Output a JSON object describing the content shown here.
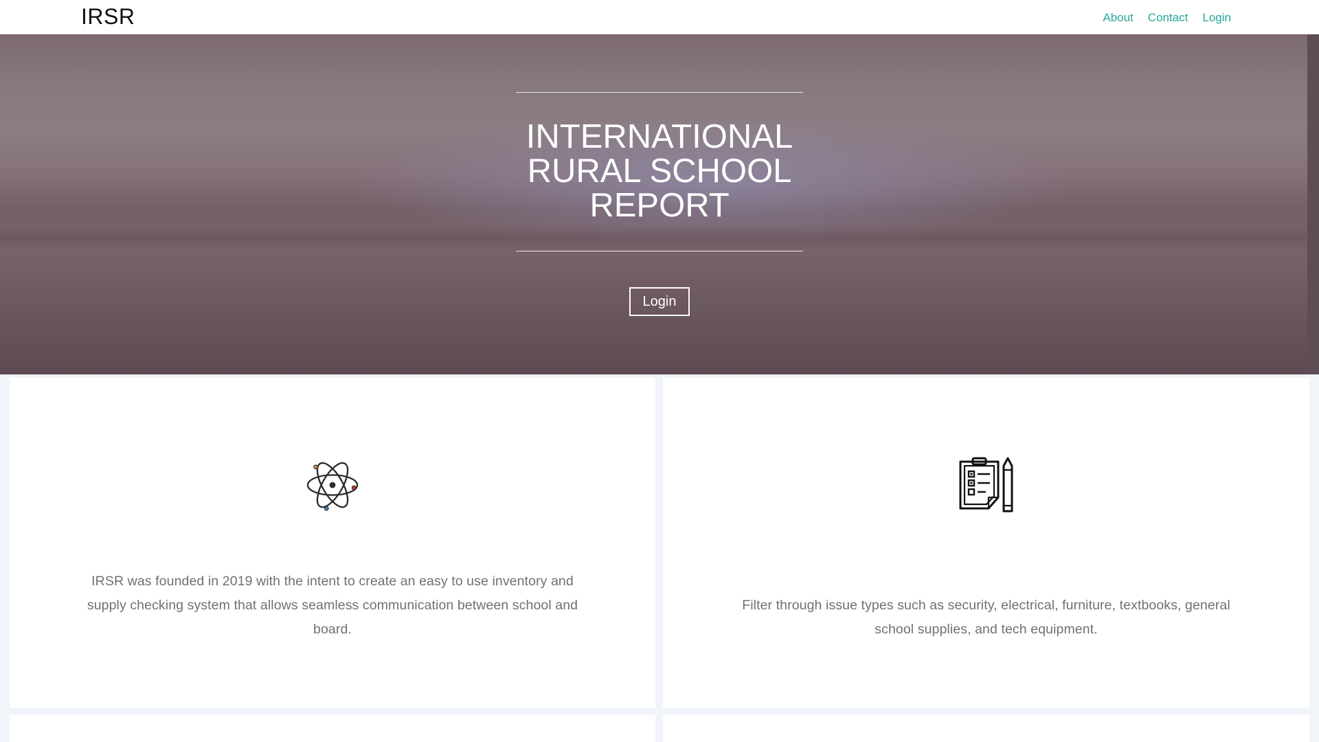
{
  "navbar": {
    "brand": "IRSR",
    "links": [
      {
        "label": "About"
      },
      {
        "label": "Contact"
      },
      {
        "label": "Login"
      }
    ],
    "link_color": "#26a69a"
  },
  "hero": {
    "title": "INTERNATIONAL RURAL SCHOOL REPORT",
    "button_label": "Login"
  },
  "features": [
    {
      "icon": "atom-icon",
      "text": "IRSR was founded in 2019 with the intent to create an easy to use inventory and supply checking system that allows seamless communication between school and board."
    },
    {
      "icon": "clipboard-checklist-icon",
      "text": "Filter through issue types such as security, electrical, furniture, textbooks, general school supplies, and tech equipment."
    }
  ]
}
